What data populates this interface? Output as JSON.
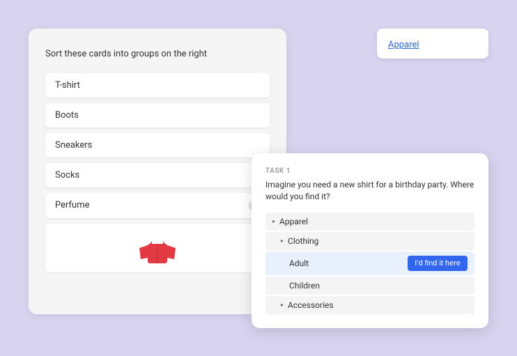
{
  "instructions": {
    "text": "Sort these cards into groups on the right"
  },
  "cards": [
    {
      "id": "tshirt",
      "label": "T-shirt",
      "hasInfo": false,
      "hasImage": false
    },
    {
      "id": "boots",
      "label": "Boots",
      "hasInfo": false,
      "hasImage": false
    },
    {
      "id": "sneakers",
      "label": "Sneakers",
      "hasInfo": false,
      "hasImage": false
    },
    {
      "id": "socks",
      "label": "Socks",
      "hasInfo": false,
      "hasImage": false
    },
    {
      "id": "perfume",
      "label": "Perfume",
      "hasInfo": true,
      "hasImage": false
    },
    {
      "id": "jacket",
      "label": "",
      "hasInfo": false,
      "hasImage": true
    }
  ],
  "group": {
    "label": "Apparel"
  },
  "task": {
    "label": "TASK 1",
    "question": "Imagine you need a new shirt for a birthday party. Where would you find it?",
    "find_button": "I'd find it here",
    "tree": [
      {
        "id": "apparel",
        "label": "Apparel",
        "level": 0,
        "hasArrow": true,
        "highlighted": false
      },
      {
        "id": "clothing",
        "label": "Clothing",
        "level": 1,
        "hasArrow": true,
        "highlighted": false
      },
      {
        "id": "adult",
        "label": "Adult",
        "level": 2,
        "hasArrow": false,
        "highlighted": true
      },
      {
        "id": "children",
        "label": "Children",
        "level": 2,
        "hasArrow": false,
        "highlighted": false
      },
      {
        "id": "accessories",
        "label": "Accessories",
        "level": 1,
        "hasArrow": true,
        "highlighted": false
      }
    ]
  }
}
